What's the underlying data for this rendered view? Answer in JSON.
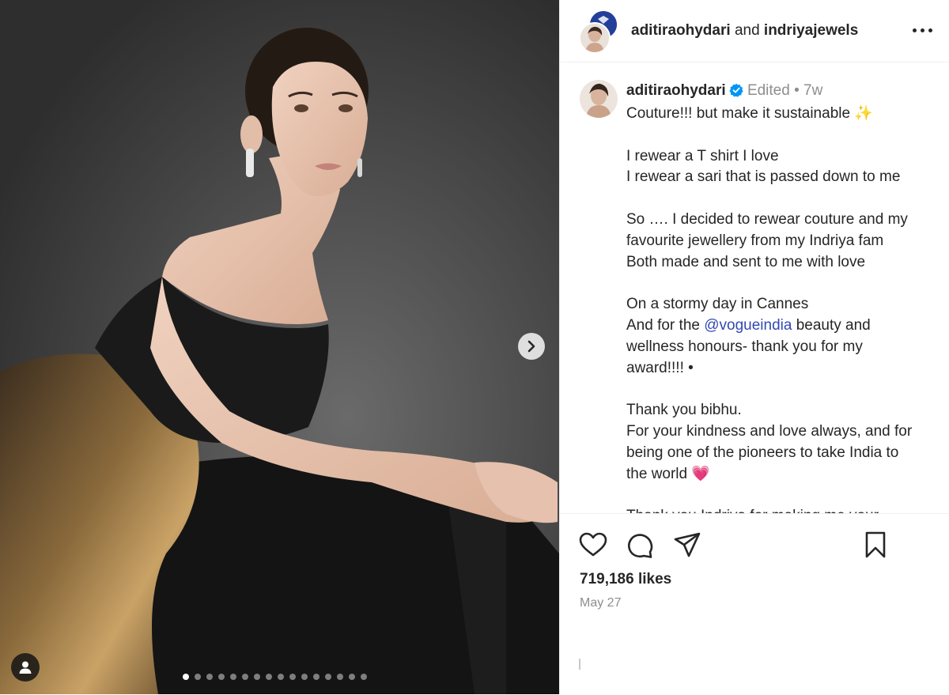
{
  "media": {
    "dots_count": 16,
    "active_dot": 1
  },
  "header": {
    "author": "aditiraohydari",
    "joiner": "and",
    "collaborator": "indriyajewels"
  },
  "caption": {
    "username": "aditiraohydari",
    "edited": "Edited",
    "separator": "•",
    "time": "7w",
    "lines": [
      "Couture!!! but make it sustainable ✨",
      "",
      "I rewear a  T shirt I love",
      "I rewear a sari that is passed down to me",
      "",
      "So …. I decided to rewear couture  and my",
      "favourite jewellery from my Indriya fam",
      "Both made and sent to me with love",
      "",
      "On a stormy day in Cannes"
    ],
    "mention_line": {
      "before": "And for the ",
      "mention": "@vogueindia",
      "after": " beauty and"
    },
    "lines_after": [
      "wellness honours- thank you for my",
      "award!!!! •",
      "",
      "Thank you bibhu.",
      "For your kindness and love always, and for",
      "being one of the pioneers to take India to",
      "the world 💗",
      "",
      "Thank you Indriya for making me your"
    ]
  },
  "footer": {
    "likes": "719,186 likes",
    "date": "May 27"
  },
  "colors": {
    "mention": "#3249b4",
    "verified": "#0095f6",
    "muted": "#8e8e8e",
    "text": "#262626"
  },
  "icons": [
    "next-arrow-icon",
    "tag-user-icon",
    "more-options-icon",
    "verified-badge-icon",
    "heart-icon",
    "comment-icon",
    "share-icon",
    "bookmark-icon"
  ]
}
